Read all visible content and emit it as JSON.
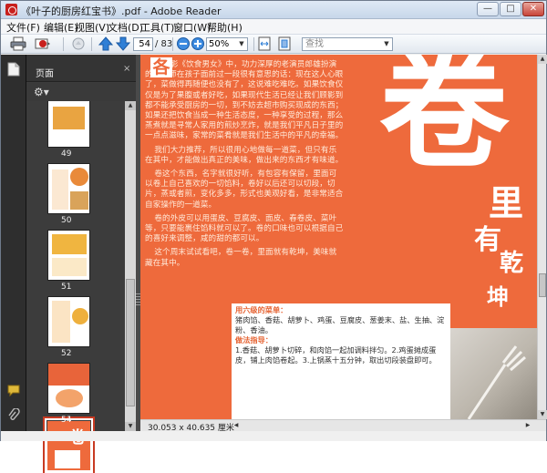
{
  "window": {
    "title": "《叶子的厨房红宝书》.pdf - Adobe Reader",
    "minimize": "—",
    "maximize": "□",
    "close": "✕"
  },
  "menu": [
    "文件(F)",
    "编辑(E)",
    "视图(V)",
    "文档(D)",
    "工具(T)",
    "窗口(W)",
    "帮助(H)"
  ],
  "toolbar": {
    "current_page": "54",
    "total_pages": "/ 83",
    "zoom": "50%",
    "search_placeholder": "查找"
  },
  "panel": {
    "title": "页面",
    "close": "×",
    "thumbnails": [
      {
        "label": "49",
        "color": "#e9a441"
      },
      {
        "label": "50",
        "color": "#e98a3a"
      },
      {
        "label": "51",
        "color": "#f0b540"
      },
      {
        "label": "52",
        "color": "#eeb03d"
      },
      {
        "label": "53",
        "color": "#e8643a"
      },
      {
        "label": "54",
        "color": "#ee6a3c"
      }
    ]
  },
  "document": {
    "dropcap": "各",
    "paragraphs": [
      "湾电影《饮食男女》中，功力深厚的老演员郎雄扮演的老厨师在孩子面前过一段很有意思的话：现在这人心眼了，菜做得再随便也没有了，这说难吃难吃。如果饮食仅仅是为了果腹或者好吃，如果现代生活已经让我们顾影到都不能承受厨房的一切，到不妨去超市购买现成的东西；如果还把饮食当成一种生活态度，一种享受的过程，那么蒸煮就是寻常人家用的煎炒烹炸，就是我们平凡日子里的一点点滋味，家常的菜肴就是我们生活中的平凡的幸福。",
      "我们大力推荐，所以很用心地做每一道菜，但只有乐在其中，才能做出真正的美味，做出来的东西才有味道。",
      "卷这个东西，名字就很好听，有包容有保留，里面可以卷上自己喜欢的一切馅料，卷好以后还可以切段，切片，蒸或者煎，变化多多，形式也美观好看，是非常适合自家操作的一道菜。",
      "卷的外皮可以用蛋皮、豆腐皮、面皮、春卷皮、菜叶等，只要能裹住馅料就可以了。卷的口味也可以根据自己的喜好来调整，咸的甜的都可以。",
      "这个周末试试看吧，卷一卷，里面就有乾坤，美味就藏在其中。"
    ],
    "big_char": "卷",
    "vertical_chars": [
      "里",
      "有",
      "乾",
      "坤"
    ],
    "lower_heading_1": "用六级的菜单：",
    "lower_body_1": "猪肉馅、香菇、胡萝卜、鸡蛋、豆腐皮、葱姜末、盐、生抽、淀粉、香油。",
    "lower_heading_2": "做法指导：",
    "lower_body_2": "1.香菇、胡萝卜切碎，和肉馅一起加调料拌匀。2.鸡蛋摊成蛋皮，铺上肉馅卷起。3.上锅蒸十五分钟，取出切段装盘即可。"
  },
  "status": {
    "page_size": "30.053 x 40.635 厘米"
  },
  "scroll": {
    "up": "▲",
    "down": "▼",
    "left": "◀",
    "right": "▶"
  }
}
